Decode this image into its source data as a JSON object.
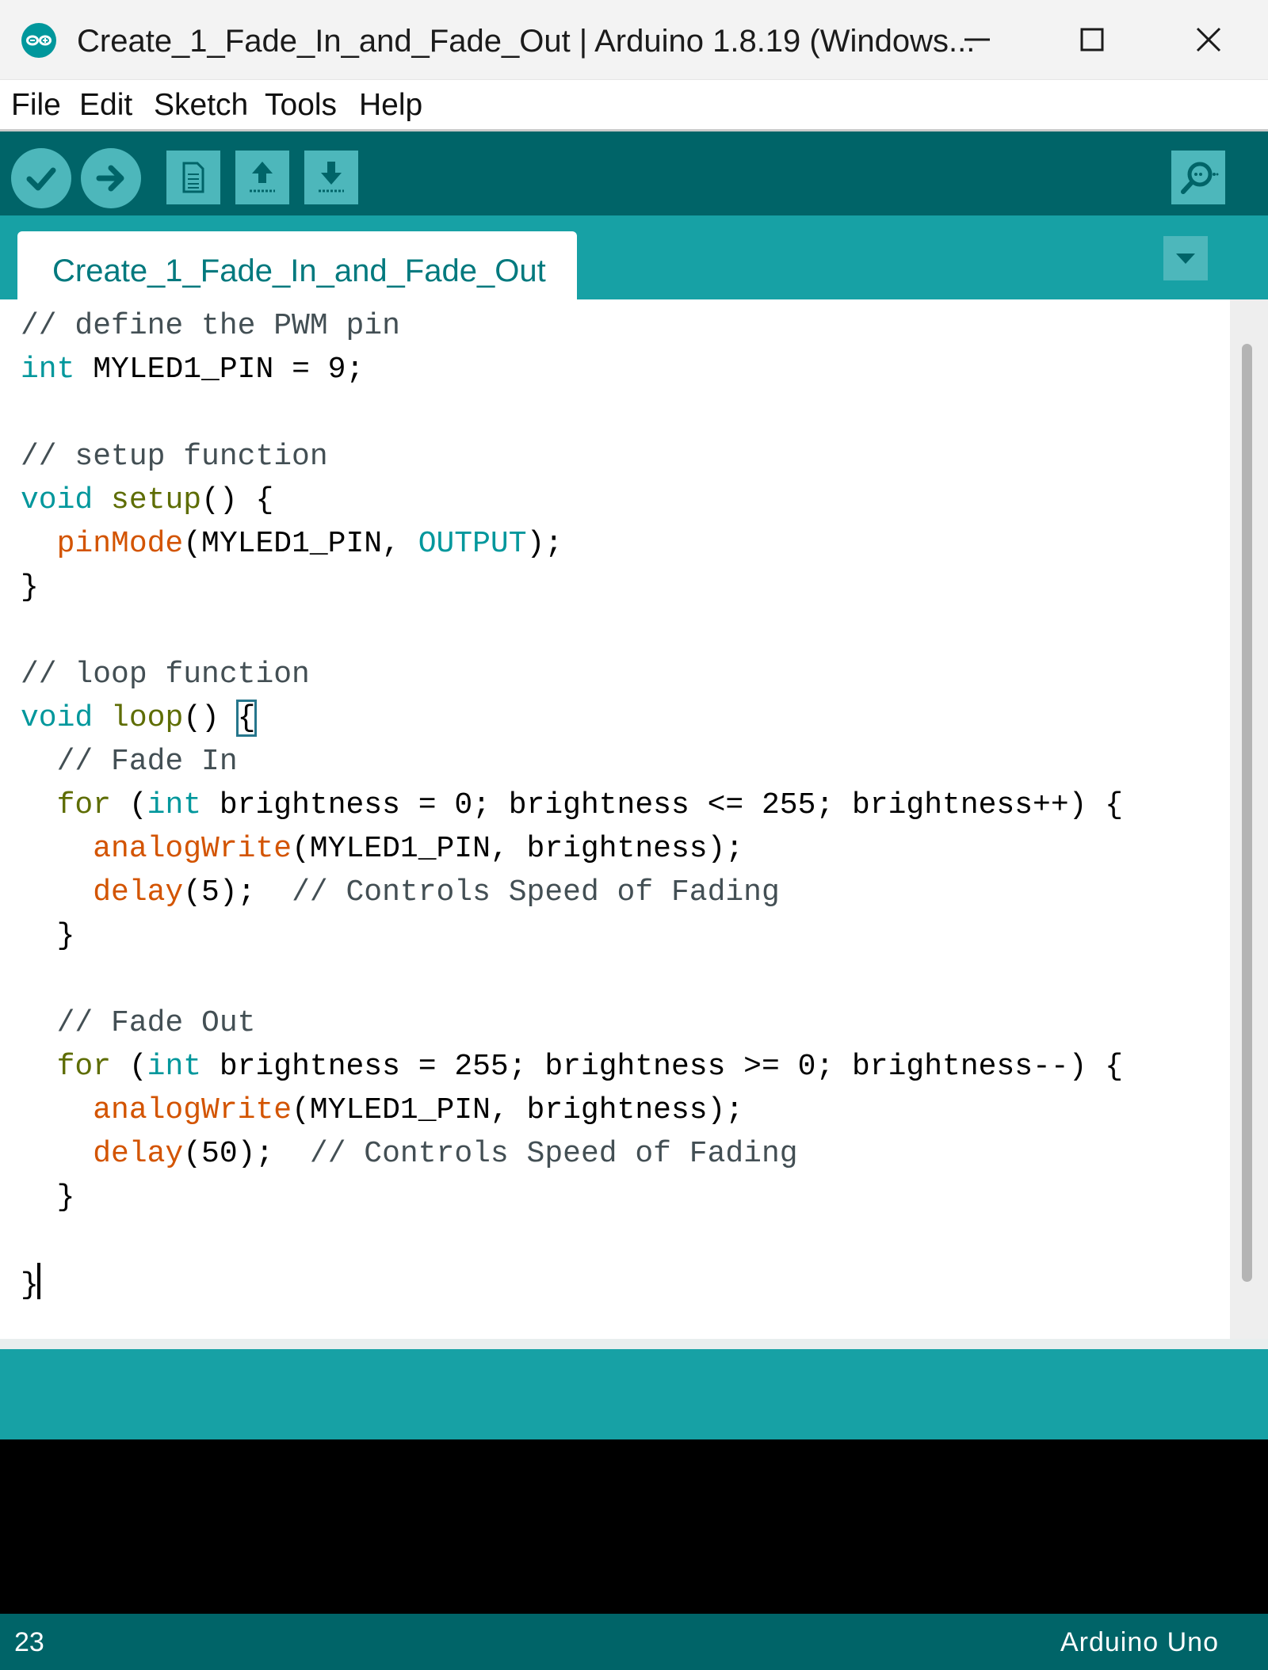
{
  "window": {
    "title": "Create_1_Fade_In_and_Fade_Out | Arduino 1.8.19 (Windows..."
  },
  "menu": {
    "items": [
      "File",
      "Edit",
      "Sketch",
      "Tools",
      "Help"
    ]
  },
  "toolbar": {
    "buttons": [
      "verify-icon",
      "upload-icon",
      "new-icon",
      "open-icon",
      "save-icon",
      "serial-monitor-icon"
    ]
  },
  "tabs": {
    "active": "Create_1_Fade_In_and_Fade_Out"
  },
  "colors": {
    "toolbar_bg": "#006468",
    "tabstrip_bg": "#17a1a5",
    "button_bg": "#4db7bb",
    "comment": "#434f54",
    "keyword": "#00979c",
    "function": "#d35400",
    "user_function": "#5e6d03"
  },
  "code": {
    "lines": [
      [
        {
          "t": "// define the PWM pin",
          "c": "cmt"
        }
      ],
      [
        {
          "t": "int",
          "c": "kw"
        },
        {
          "t": " MYLED1_PIN = 9;"
        }
      ],
      [],
      [
        {
          "t": "// setup function",
          "c": "cmt"
        }
      ],
      [
        {
          "t": "void",
          "c": "kw"
        },
        {
          "t": " "
        },
        {
          "t": "setup",
          "c": "fn2"
        },
        {
          "t": "() {"
        }
      ],
      [
        {
          "t": "  "
        },
        {
          "t": "pinMode",
          "c": "fn"
        },
        {
          "t": "(MYLED1_PIN, "
        },
        {
          "t": "OUTPUT",
          "c": "kw"
        },
        {
          "t": ");"
        }
      ],
      [
        {
          "t": "}"
        }
      ],
      [],
      [
        {
          "t": "// loop function",
          "c": "cmt"
        }
      ],
      [
        {
          "t": "void",
          "c": "kw"
        },
        {
          "t": " "
        },
        {
          "t": "loop",
          "c": "fn2"
        },
        {
          "t": "() "
        },
        {
          "t": "{",
          "c": "bracket"
        }
      ],
      [
        {
          "t": "  "
        },
        {
          "t": "// Fade In",
          "c": "cmt"
        }
      ],
      [
        {
          "t": "  "
        },
        {
          "t": "for",
          "c": "fn2"
        },
        {
          "t": " ("
        },
        {
          "t": "int",
          "c": "kw"
        },
        {
          "t": " brightness = 0; brightness <= 255; brightness++) {"
        }
      ],
      [
        {
          "t": "    "
        },
        {
          "t": "analogWrite",
          "c": "fn"
        },
        {
          "t": "(MYLED1_PIN, brightness);"
        }
      ],
      [
        {
          "t": "    "
        },
        {
          "t": "delay",
          "c": "fn"
        },
        {
          "t": "(5);  "
        },
        {
          "t": "// Controls Speed of Fading",
          "c": "cmt"
        }
      ],
      [
        {
          "t": "  }"
        }
      ],
      [],
      [
        {
          "t": "  "
        },
        {
          "t": "// Fade Out",
          "c": "cmt"
        }
      ],
      [
        {
          "t": "  "
        },
        {
          "t": "for",
          "c": "fn2"
        },
        {
          "t": " ("
        },
        {
          "t": "int",
          "c": "kw"
        },
        {
          "t": " brightness = 255; brightness >= 0; brightness--) {"
        }
      ],
      [
        {
          "t": "    "
        },
        {
          "t": "analogWrite",
          "c": "fn"
        },
        {
          "t": "(MYLED1_PIN, brightness);"
        }
      ],
      [
        {
          "t": "    "
        },
        {
          "t": "delay",
          "c": "fn"
        },
        {
          "t": "(50);  "
        },
        {
          "t": "// Controls Speed of Fading",
          "c": "cmt"
        }
      ],
      [
        {
          "t": "  }"
        }
      ],
      [],
      [
        {
          "t": "}"
        },
        {
          "t": "",
          "c": "caret"
        }
      ]
    ]
  },
  "status": {
    "line": "23",
    "board": "Arduino Uno"
  }
}
